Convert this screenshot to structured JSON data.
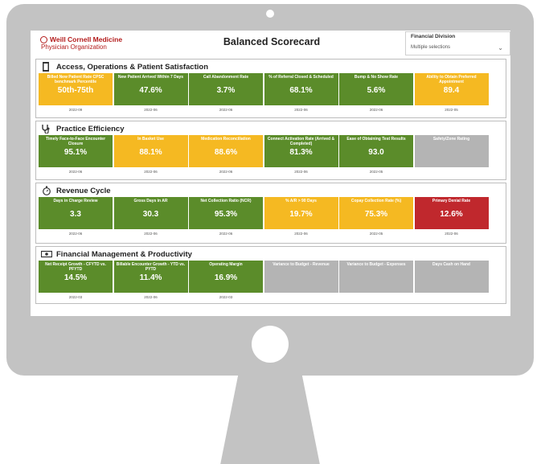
{
  "header": {
    "logo_line1": "Weill Cornell Medicine",
    "logo_line2": "Physician Organization",
    "title": "Balanced Scorecard",
    "filter_label": "Financial Division",
    "filter_value": "Multiple selections"
  },
  "sections": [
    {
      "title": "Access, Operations & Patient Satisfaction",
      "tiles": [
        {
          "label": "Billed New Patient Rate CPSC benchmark Percentile",
          "value": "50th-75th",
          "date": "2022-09",
          "color": "yellow"
        },
        {
          "label": "New Patient Arrived Within 7 Days",
          "value": "47.6%",
          "date": "2022-06",
          "color": "green"
        },
        {
          "label": "Call Abandonment Rate",
          "value": "3.7%",
          "date": "2022-06",
          "color": "green"
        },
        {
          "label": "% of Referral Closed & Scheduled",
          "value": "68.1%",
          "date": "2022-06",
          "color": "green"
        },
        {
          "label": "Bump & No Show Rate",
          "value": "5.6%",
          "date": "2022-06",
          "color": "green"
        },
        {
          "label": "Ability to Obtain Preferred Appointment",
          "value": "89.4",
          "date": "2022-05",
          "color": "yellow"
        }
      ]
    },
    {
      "title": "Practice Efficiency",
      "tiles": [
        {
          "label": "Timely Face-to-Face Encounter Closure",
          "value": "95.1%",
          "date": "2022-06",
          "color": "green"
        },
        {
          "label": "In Basket Use",
          "value": "88.1%",
          "date": "2022-06",
          "color": "yellow"
        },
        {
          "label": "Medication Reconciliation",
          "value": "88.6%",
          "date": "2022-06",
          "color": "yellow"
        },
        {
          "label": "Connect Activation Rate (Arrived & Completed)",
          "value": "81.3%",
          "date": "2022-06",
          "color": "green"
        },
        {
          "label": "Ease of Obtaining Test Results",
          "value": "93.0",
          "date": "2022-05",
          "color": "green"
        },
        {
          "label": "Safety/Zone Rating",
          "value": "",
          "date": "",
          "color": "gray"
        }
      ]
    },
    {
      "title": "Revenue Cycle",
      "tiles": [
        {
          "label": "Days in Charge Review",
          "value": "3.3",
          "date": "2022-06",
          "color": "green"
        },
        {
          "label": "Gross Days in AR",
          "value": "30.3",
          "date": "2022-06",
          "color": "green"
        },
        {
          "label": "Net Collection Ratio (NCR)",
          "value": "95.3%",
          "date": "2022-06",
          "color": "green"
        },
        {
          "label": "% A/R > 90 Days",
          "value": "19.7%",
          "date": "2022-06",
          "color": "yellow"
        },
        {
          "label": "Copay Collection Rate (%)",
          "value": "75.3%",
          "date": "2022-05",
          "color": "yellow"
        },
        {
          "label": "Primary Denial Rate",
          "value": "12.6%",
          "date": "2022-06",
          "color": "red"
        }
      ]
    },
    {
      "title": "Financial Management & Productivity",
      "tiles": [
        {
          "label": "Net Receipt Growth - CFYTD vs. PFYTD",
          "value": "14.5%",
          "date": "2022-03",
          "color": "green"
        },
        {
          "label": "Billable Encounter Growth - YTD vs. PYTD",
          "value": "11.4%",
          "date": "2022-06",
          "color": "green"
        },
        {
          "label": "Operating Margin",
          "value": "16.9%",
          "date": "2022-03",
          "color": "green"
        },
        {
          "label": "Variance to Budget - Revenue",
          "value": "",
          "date": "",
          "color": "gray"
        },
        {
          "label": "Variance to Budget - Expenses",
          "value": "",
          "date": "",
          "color": "gray"
        },
        {
          "label": "Days Cash on Hand",
          "value": "",
          "date": "",
          "color": "gray"
        }
      ]
    }
  ],
  "icons": [
    "clipboard-icon",
    "stethoscope-icon",
    "stopwatch-icon",
    "money-icon",
    "chevron-down-icon"
  ]
}
